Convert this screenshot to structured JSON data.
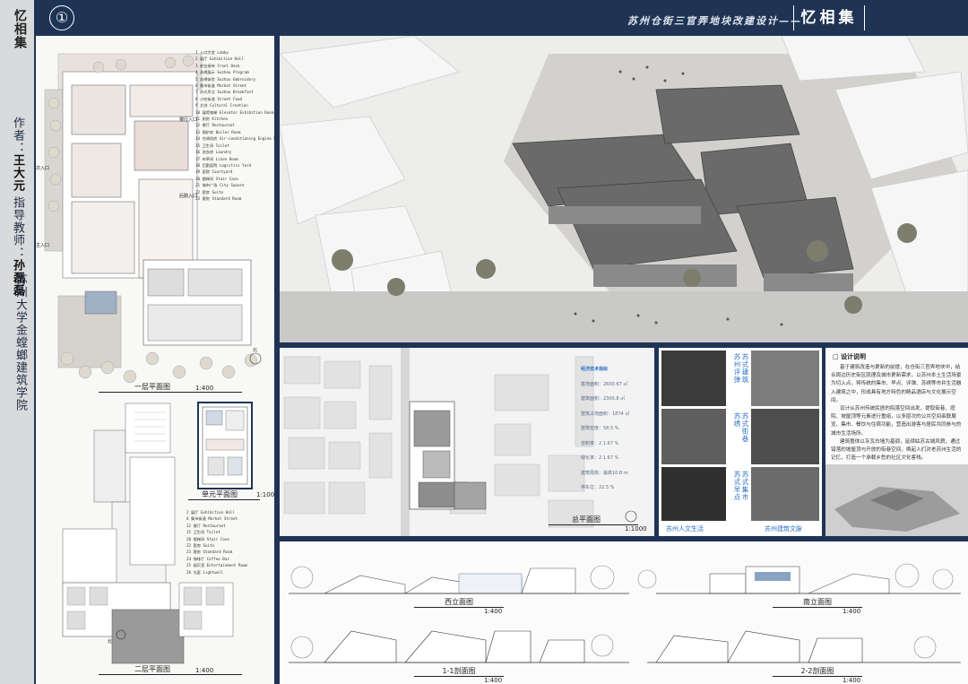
{
  "sheet": {
    "number": "①",
    "subtitle": "苏州仓街三官弄地块改建设计——",
    "logo": "忆相集",
    "accent": "#1f3455"
  },
  "spine": {
    "title": "忆相集",
    "author_label": "作者：",
    "author": "王大元",
    "advisor_label": "指导教师：",
    "advisor": "孙磊磊",
    "school": "苏州大学金螳螂建筑学院"
  },
  "ground_plan": {
    "title": "一层平面图",
    "scale": "1:400",
    "entrances": {
      "main": "主入口",
      "secondary": "次入口",
      "loading": "后勤入口",
      "slow": "慢行入口"
    },
    "legend": [
      "1 入口大堂 Lobby",
      "2 展厅 Exhibition Hall",
      "3 前台接待 Front Desk",
      "4 苏绣展示 Suzhou Program",
      "5 苏绣体验 Suzhou Embroidery",
      "6 集市街道 Market Street",
      "7 苏式早点 Suzhou Breakfast",
      "8 小吃街道 Street Food",
      "9 文创 Cultural Creation",
      "10 展馆电梯 Elevator Exhibition Room",
      "11 厨房 Kitchen",
      "12 餐厅 Restaurant",
      "13 锅炉房 Boiler Room",
      "14 空调机房 Air-conditioning Engine Room",
      "15 卫生间 Toilet",
      "16 洗衣房 Laundry",
      "17 布草间 Linen Room",
      "18 后勤庭院 Logistics Yard",
      "19 庭院 Courtyard",
      "20 楼梯间 Stair Case",
      "21 城市广场 City Square",
      "22 套房 Suite",
      "23 客房 Standard Room"
    ]
  },
  "unit_plan": {
    "title": "单元平面图",
    "scale": "1:100"
  },
  "second_plan": {
    "title": "二层平面图",
    "scale": "1:400",
    "north": "北",
    "legend": [
      "2 展厅 Exhibition Hall",
      "6 集市街道 Market Street",
      "12 餐厅 Restaurant",
      "15 卫生间 Toilet",
      "20 楼梯间 Stair Case",
      "22 套房 Suite",
      "23 客房 Standard Room",
      "24 咖啡厅 Coffee Bar",
      "25 娱乐室 Entertainment Room",
      "26 光庭 Lightwell"
    ]
  },
  "site_plan": {
    "title": "总平面图",
    "scale": "1:1000",
    "stats_title": "经济技术指标",
    "stats": [
      "基地面积：2600.67 ㎡",
      "建筑面积：2300.8 ㎡",
      "建筑占地面积：1874 ㎡",
      "建筑密度：58.5 %",
      "容积率：2 1.67 %",
      "绿化率：2 1.67 %",
      "建筑限高：最高10.8 m",
      "停车位：22.5 %"
    ]
  },
  "photos": {
    "cap_left": "苏州人文生活",
    "cap_right": "苏州建筑文脉",
    "vlabels": [
      "苏州评弹",
      "苏式建筑",
      "苏绣",
      "苏式街巷",
      "苏式早点",
      "苏式集市"
    ]
  },
  "description": {
    "title": "设计说明",
    "paragraphs": [
      "基于建筑改造与更新的前提，在仓街三官弄地块中，结合周边历史街区肌理及城市更新需求，以苏州本土生活场景为切入点，将传统的集市、早点、评弹、苏绣等市井生活融入建筑之中，形成具有地方特色的精品酒店与文化展示空间。",
      "设计从苏州传统民居的院落空间出发，提取街巷、庭院、坡屋顶等元素进行重组，以多层次的公共空间串联展览、集市、餐饮与住宿功能，营造出游客与居民共同参与的城市生活场所。",
      "建筑整体以灰瓦白墙为基调，延续姑苏古城风貌，通过错落的坡屋顶与开放的街巷空间，唤起人们对老苏州生活的记忆，打造一个承载乡愁的社区文化客栈。"
    ]
  },
  "elevations": {
    "west": {
      "title": "西立面图",
      "scale": "1:400"
    },
    "south": {
      "title": "南立面图",
      "scale": "1:400"
    },
    "section1": {
      "title": "1-1剖面图",
      "scale": "1:400"
    },
    "section2": {
      "title": "2-2剖面图",
      "scale": "1:400"
    }
  }
}
